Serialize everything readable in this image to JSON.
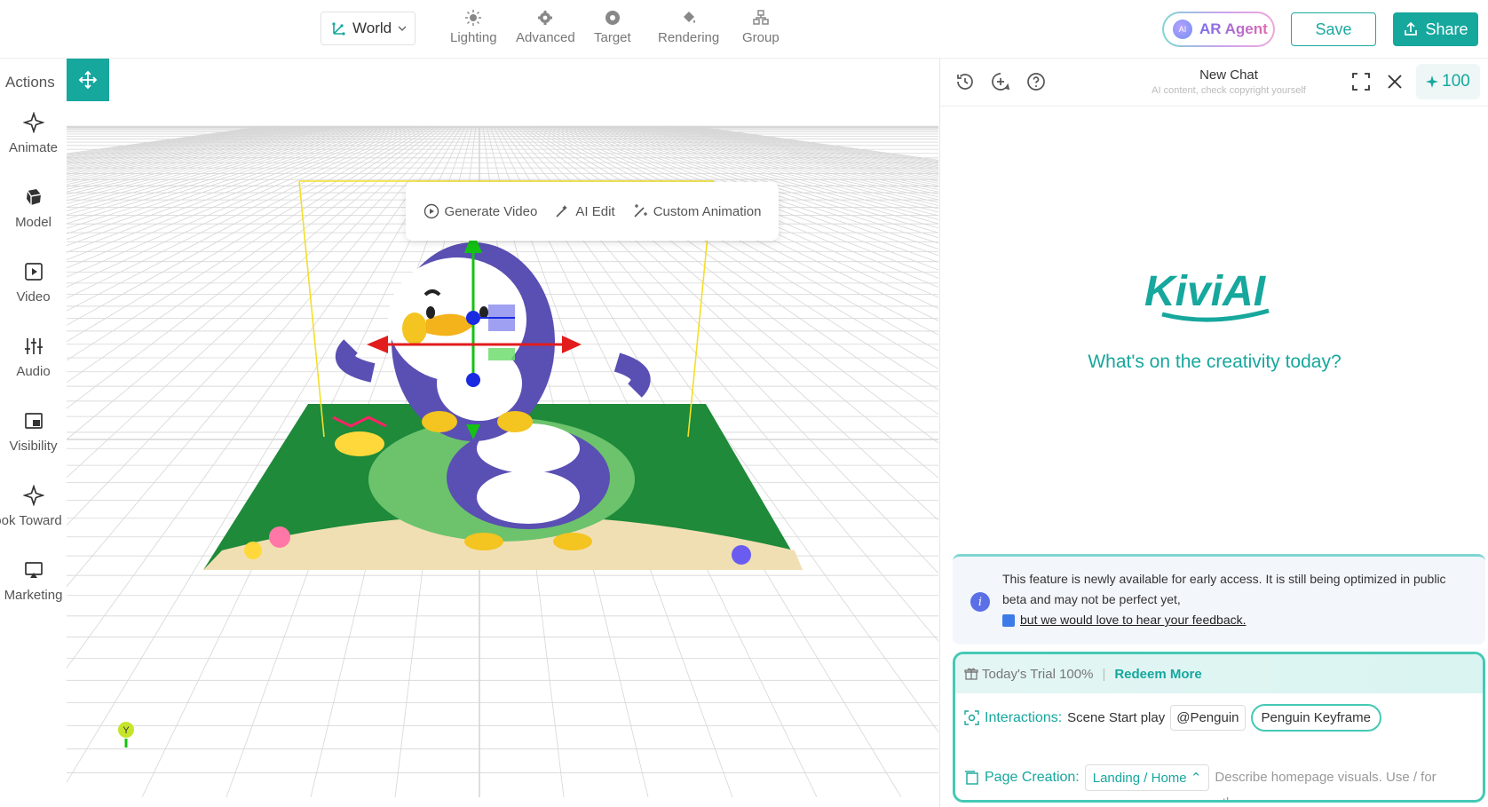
{
  "topbar": {
    "world_label": "World",
    "tools": [
      {
        "label": "Lighting",
        "icon": "sun-icon"
      },
      {
        "label": "Advanced",
        "icon": "gear-icon"
      },
      {
        "label": "Target",
        "icon": "target-icon"
      },
      {
        "label": "Rendering",
        "icon": "paint-bucket-icon"
      },
      {
        "label": "Group",
        "icon": "group-icon"
      }
    ],
    "ar_agent_label": "AR Agent",
    "ar_agent_badge": "AI",
    "save_label": "Save",
    "share_label": "Share"
  },
  "actions": {
    "title": "Actions",
    "items": [
      {
        "label": "Animate",
        "icon": "sparkle-icon"
      },
      {
        "label": "Model",
        "icon": "cube-icon"
      },
      {
        "label": "Video",
        "icon": "play-icon"
      },
      {
        "label": "Audio",
        "icon": "sliders-icon"
      },
      {
        "label": "Visibility",
        "icon": "picture-in-picture-icon"
      },
      {
        "label": "ook Toward",
        "icon": "sparkle-icon"
      },
      {
        "label": "Marketing",
        "icon": "screen-icon"
      }
    ]
  },
  "tools": [
    "move-icon",
    "rotate-icon",
    "scale-icon",
    "trash-icon",
    "crosshair-icon",
    "fit-icon",
    "eye-icon"
  ],
  "floating_bar": {
    "generate_video": "Generate Video",
    "ai_edit": "AI Edit",
    "custom_animation": "Custom Animation"
  },
  "scene": {
    "axis_marker_label": "Y"
  },
  "chat": {
    "title": "New Chat",
    "subtitle": "AI content, check copyright yourself",
    "credits": "100",
    "brand": "KiviAI",
    "welcome": "What's on the creativity today?",
    "notice_text": "This feature is newly available for early access. It is still being optimized in public beta and may not be perfect yet,",
    "notice_link": "but we would love to hear your feedback.",
    "trial_text": "Today's Trial 100%",
    "trial_sep": "|",
    "redeem": "Redeem More",
    "interactions_label": "Interactions:",
    "interactions_value": "Scene Start play",
    "mention": "@Penguin",
    "keyframe_chip": "Penguin Keyframe",
    "page_creation_label": "Page Creation:",
    "page_chip": "Landing / Home",
    "page_placeholder": "Describe homepage visuals. Use / for other page."
  },
  "colors": {
    "accent": "#16a79d",
    "grid": "#d6d6d6",
    "gizmo_red": "#e21c1c",
    "gizmo_green": "#13c213",
    "gizmo_blue": "#1a2ae0"
  }
}
